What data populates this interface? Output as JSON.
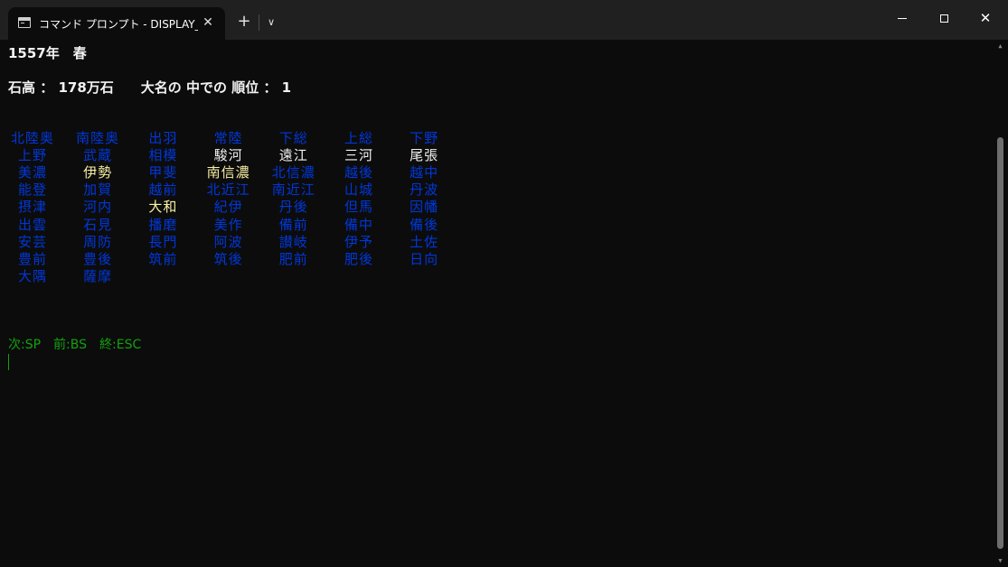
{
  "window": {
    "tab_title": "コマンド プロンプト - DISPLAY_TUR",
    "tab_icon": "terminal-icon",
    "new_tab_label": "+",
    "dropdown_label": "∨",
    "close_tab_label": "✕",
    "close_window_label": "✕"
  },
  "colors": {
    "background": "#0c0c0c",
    "chrome": "#202020",
    "header_text": "#f2f2f2",
    "blue": "#0037da",
    "white": "#f2f2f2",
    "yellow": "#f9f1a5",
    "green": "#13a10e"
  },
  "header": {
    "date_line": "1557年　春",
    "status_line": "石高 ： 178万石　　大名の 中での 順位 ： 1"
  },
  "provinces": [
    [
      "北陸奥",
      "南陸奥",
      "出羽",
      "常陸",
      "下総",
      "上総",
      "下野"
    ],
    [
      "上野",
      "武蔵",
      "相模",
      "駿河",
      "遠江",
      "三河",
      "尾張"
    ],
    [
      "美濃",
      "伊勢",
      "甲斐",
      "南信濃",
      "北信濃",
      "越後",
      "越中"
    ],
    [
      "能登",
      "加賀",
      "越前",
      "北近江",
      "南近江",
      "山城",
      "丹波"
    ],
    [
      "摂津",
      "河内",
      "大和",
      "紀伊",
      "丹後",
      "但馬",
      "因幡"
    ],
    [
      "出雲",
      "石見",
      "播磨",
      "美作",
      "備前",
      "備中",
      "備後"
    ],
    [
      "安芸",
      "周防",
      "長門",
      "阿波",
      "讃岐",
      "伊予",
      "土佐"
    ],
    [
      "豊前",
      "豊後",
      "筑前",
      "筑後",
      "肥前",
      "肥後",
      "日向"
    ],
    [
      "大隅",
      "薩摩"
    ]
  ],
  "province_status": [
    [
      "blue",
      "blue",
      "blue",
      "blue",
      "blue",
      "blue",
      "blue"
    ],
    [
      "blue",
      "blue",
      "blue",
      "white",
      "white",
      "white",
      "white"
    ],
    [
      "blue",
      "yellow",
      "blue",
      "yellow",
      "blue",
      "blue",
      "blue"
    ],
    [
      "blue",
      "blue",
      "blue",
      "blue",
      "blue",
      "blue",
      "blue"
    ],
    [
      "blue",
      "blue",
      "yellow",
      "blue",
      "blue",
      "blue",
      "blue"
    ],
    [
      "blue",
      "blue",
      "blue",
      "blue",
      "blue",
      "blue",
      "blue"
    ],
    [
      "blue",
      "blue",
      "blue",
      "blue",
      "blue",
      "blue",
      "blue"
    ],
    [
      "blue",
      "blue",
      "blue",
      "blue",
      "blue",
      "blue",
      "blue"
    ],
    [
      "blue",
      "blue"
    ]
  ],
  "footer": {
    "controls": "次:SP　前:BS　終:ESC"
  }
}
